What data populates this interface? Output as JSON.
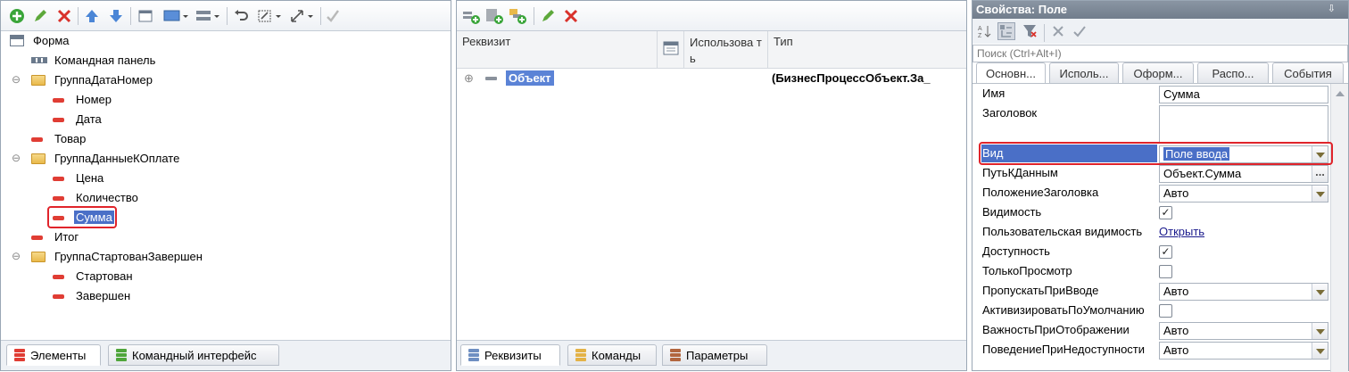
{
  "elements_pane": {
    "tree": [
      {
        "label": "Форма",
        "icon": "form-icon",
        "indent": 0
      },
      {
        "label": "Командная панель",
        "icon": "command-bar-icon",
        "indent": 1
      },
      {
        "label": "ГруппаДатаНомер",
        "icon": "folder-icon",
        "indent": 1,
        "expander": "⊖"
      },
      {
        "label": "Номер",
        "icon": "attribute-icon",
        "indent": 2
      },
      {
        "label": "Дата",
        "icon": "attribute-icon",
        "indent": 2
      },
      {
        "label": "Товар",
        "icon": "attribute-icon",
        "indent": 1
      },
      {
        "label": "ГруппаДанныеКОплате",
        "icon": "folder-icon",
        "indent": 1,
        "expander": "⊖"
      },
      {
        "label": "Цена",
        "icon": "attribute-icon",
        "indent": 2
      },
      {
        "label": "Количество",
        "icon": "attribute-icon",
        "indent": 2
      },
      {
        "label": "Сумма",
        "icon": "attribute-icon",
        "indent": 2,
        "selected": true
      },
      {
        "label": "Итог",
        "icon": "attribute-icon",
        "indent": 1
      },
      {
        "label": "ГруппаСтартованЗавершен",
        "icon": "folder-icon",
        "indent": 1,
        "expander": "⊖"
      },
      {
        "label": "Стартован",
        "icon": "attribute-icon",
        "indent": 2
      },
      {
        "label": "Завершен",
        "icon": "attribute-icon",
        "indent": 2
      }
    ],
    "tabs": [
      {
        "label": "Элементы",
        "active": true
      },
      {
        "label": "Командный интерфейс",
        "active": false
      }
    ]
  },
  "attributes_pane": {
    "columns": [
      "Реквизит",
      "Использова ть",
      "Тип"
    ],
    "row": {
      "expander": "⊕",
      "name": "Объект",
      "type": "(БизнесПроцессОбъект.За_"
    },
    "tabs": [
      {
        "label": "Реквизиты",
        "active": true
      },
      {
        "label": "Команды",
        "active": false
      },
      {
        "label": "Параметры",
        "active": false
      }
    ]
  },
  "properties": {
    "title": "Свойства: Поле",
    "pin": "⇩",
    "search_placeholder": "Поиск (Ctrl+Alt+I)",
    "tabs": [
      "Основн...",
      "Исполь...",
      "Оформ...",
      "Распо...",
      "События"
    ],
    "rows": [
      {
        "label": "Имя",
        "kind": "text",
        "value": "Сумма"
      },
      {
        "label": "Заголовок",
        "kind": "textarea",
        "value": ""
      },
      {
        "label": "Вид",
        "kind": "select",
        "value": "Поле ввода",
        "highlighted": true
      },
      {
        "label": "ПутьКДанным",
        "kind": "ellipsis",
        "value": "Объект.Сумма"
      },
      {
        "label": "ПоложениеЗаголовка",
        "kind": "select",
        "value": "Авто"
      },
      {
        "label": "Видимость",
        "kind": "checkbox",
        "checked": true
      },
      {
        "label": "Пользовательская видимость",
        "kind": "link",
        "value": "Открыть"
      },
      {
        "label": "Доступность",
        "kind": "checkbox",
        "checked": true
      },
      {
        "label": "ТолькоПросмотр",
        "kind": "checkbox",
        "checked": false
      },
      {
        "label": "ПропускатьПриВводе",
        "kind": "select",
        "value": "Авто"
      },
      {
        "label": "АктивизироватьПоУмолчанию",
        "kind": "checkbox",
        "checked": false
      },
      {
        "label": "ВажностьПриОтображении",
        "kind": "select",
        "value": "Авто"
      },
      {
        "label": "ПоведениеПриНедоступности",
        "kind": "select",
        "value": "Авто"
      }
    ]
  },
  "colors": {
    "selection": "#4a6fc7",
    "highlight_border": "#e0242b",
    "pane_border": "#9aa7b5",
    "title_bar": "#7c8897"
  }
}
